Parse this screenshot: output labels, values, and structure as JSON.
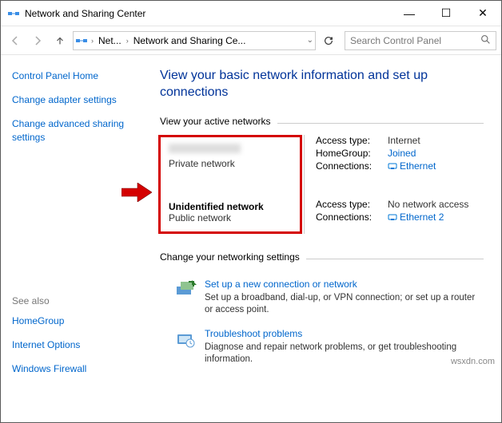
{
  "window": {
    "title": "Network and Sharing Center"
  },
  "nav": {
    "bc1": "Net...",
    "bc2": "Network and Sharing Ce...",
    "search_placeholder": "Search Control Panel"
  },
  "sidebar": {
    "home": "Control Panel Home",
    "adapter": "Change adapter settings",
    "advanced": "Change advanced sharing settings",
    "seealso": "See also",
    "homegroup": "HomeGroup",
    "inetopt": "Internet Options",
    "firewall": "Windows Firewall"
  },
  "content": {
    "heading": "View your basic network information and set up connections",
    "view_active": "View your active networks",
    "change_net": "Change your networking settings",
    "net1_type": "Private network",
    "net2_name": "Unidentified network",
    "net2_type": "Public network",
    "info1": {
      "access_lbl": "Access type:",
      "access_val": "Internet",
      "hg_lbl": "HomeGroup:",
      "hg_val": "Joined",
      "conn_lbl": "Connections:",
      "conn_val": "Ethernet"
    },
    "info2": {
      "access_lbl": "Access type:",
      "access_val": "No network access",
      "conn_lbl": "Connections:",
      "conn_val": "Ethernet 2"
    },
    "setup": {
      "title": "Set up a new connection or network",
      "desc": "Set up a broadband, dial-up, or VPN connection; or set up a router or access point."
    },
    "troubleshoot": {
      "title": "Troubleshoot problems",
      "desc": "Diagnose and repair network problems, or get troubleshooting information."
    }
  },
  "watermark": "wsxdn.com"
}
